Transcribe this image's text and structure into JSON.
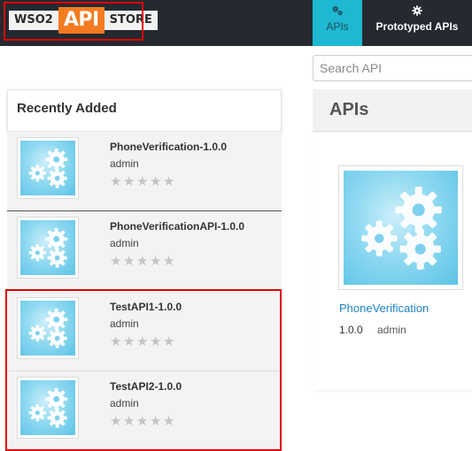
{
  "header": {
    "logo": {
      "wso2": "WSO2",
      "api": "API",
      "store": "STORE"
    },
    "tabs": [
      {
        "label": "APIs",
        "icon": "gears-icon",
        "active": true
      },
      {
        "label": "Prototyped APIs",
        "icon": "gear-icon",
        "active": false
      }
    ],
    "accent_color": "#1fb8d2",
    "brand_color": "#f47b20"
  },
  "search": {
    "placeholder": "Search API",
    "value": ""
  },
  "recently_added": {
    "title": "Recently Added",
    "items": [
      {
        "name": "PhoneVerification-1.0.0",
        "owner": "admin",
        "rating": 0,
        "max_rating": 5
      },
      {
        "name": "PhoneVerificationAPI-1.0.0",
        "owner": "admin",
        "rating": 0,
        "max_rating": 5
      },
      {
        "name": "TestAPI1-1.0.0",
        "owner": "admin",
        "rating": 0,
        "max_rating": 5
      },
      {
        "name": "TestAPI2-1.0.0",
        "owner": "admin",
        "rating": 0,
        "max_rating": 5
      }
    ]
  },
  "apis": {
    "title": "APIs",
    "cards": [
      {
        "name": "PhoneVerification",
        "version": "1.0.0",
        "owner": "admin"
      }
    ]
  },
  "highlight_color": "#e00000"
}
